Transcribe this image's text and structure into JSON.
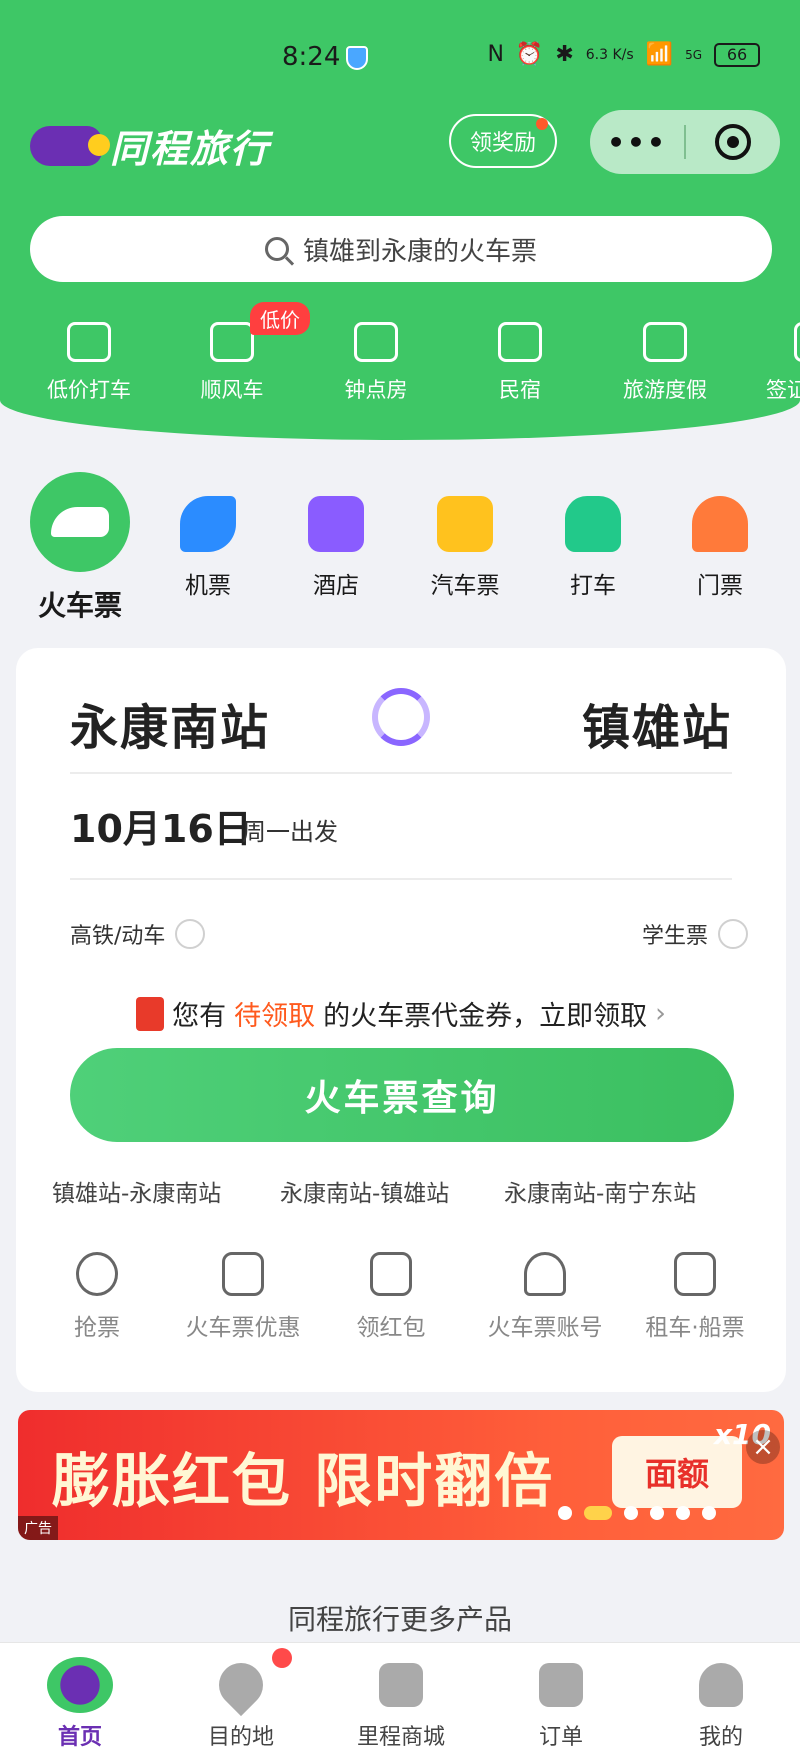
{
  "status_bar": {
    "time": "8:24",
    "network_speed": "6.3 K/s",
    "signal": "5G",
    "battery": "66"
  },
  "header": {
    "app_name": "同程旅行",
    "reward_label": "领奖励",
    "capsule_more": "•••"
  },
  "search": {
    "placeholder": "镇雄到永康的火车票"
  },
  "quick_services": [
    {
      "label": "低价打车",
      "icon": "car-icon"
    },
    {
      "label": "顺风车",
      "icon": "carpool-icon",
      "badge": "低价"
    },
    {
      "label": "钟点房",
      "icon": "hourly-room-icon"
    },
    {
      "label": "民宿",
      "icon": "homestay-icon"
    },
    {
      "label": "旅游度假",
      "icon": "mountain-icon"
    },
    {
      "label": "签证",
      "icon": "visa-icon"
    }
  ],
  "categories": [
    {
      "label": "火车票",
      "icon": "train-icon",
      "active": true
    },
    {
      "label": "机票",
      "icon": "plane-icon",
      "color": "#2b8cff"
    },
    {
      "label": "酒店",
      "icon": "hotel-icon",
      "color": "#8a5cff"
    },
    {
      "label": "汽车票",
      "icon": "bus-icon",
      "color": "#ffc21e"
    },
    {
      "label": "打车",
      "icon": "taxi-icon",
      "color": "#22c98a"
    },
    {
      "label": "门票",
      "icon": "temple-icon",
      "color": "#ff7a3a"
    }
  ],
  "booking": {
    "from_station": "永康南站",
    "to_station": "镇雄站",
    "date": "10月16日",
    "date_sub": "周一出发",
    "option_left": "高铁/动车",
    "option_right": "学生票",
    "coupon_prefix": "您有",
    "coupon_highlight": "待领取",
    "coupon_suffix": "的火车票代金券，立即领取",
    "query_button": "火车票查询",
    "history": [
      "镇雄站-永康南站",
      "永康南站-镇雄站",
      "永康南站-南宁东站"
    ],
    "tools": [
      {
        "label": "抢票",
        "icon": "stopwatch-icon"
      },
      {
        "label": "火车票优惠",
        "icon": "coupon-icon"
      },
      {
        "label": "领红包",
        "icon": "red-packet-icon"
      },
      {
        "label": "火车票账号",
        "icon": "account-icon"
      },
      {
        "label": "租车·船票",
        "icon": "rental-icon"
      }
    ]
  },
  "banner": {
    "title": "膨胀红包 限时翻倍",
    "face_label": "面额",
    "multiplier": "x10",
    "ad_label": "广告",
    "close": "×"
  },
  "more_products": "同程旅行更多产品",
  "tabbar": [
    {
      "label": "首页",
      "icon": "home-mascot-icon",
      "active": true
    },
    {
      "label": "目的地",
      "icon": "location-pin-icon"
    },
    {
      "label": "里程商城",
      "icon": "shopping-bag-icon"
    },
    {
      "label": "订单",
      "icon": "order-icon"
    },
    {
      "label": "我的",
      "icon": "profile-icon"
    }
  ],
  "colors": {
    "brand_green": "#3ec766",
    "brand_purple": "#6b2fb3",
    "highlight_orange": "#ff5a1e"
  }
}
